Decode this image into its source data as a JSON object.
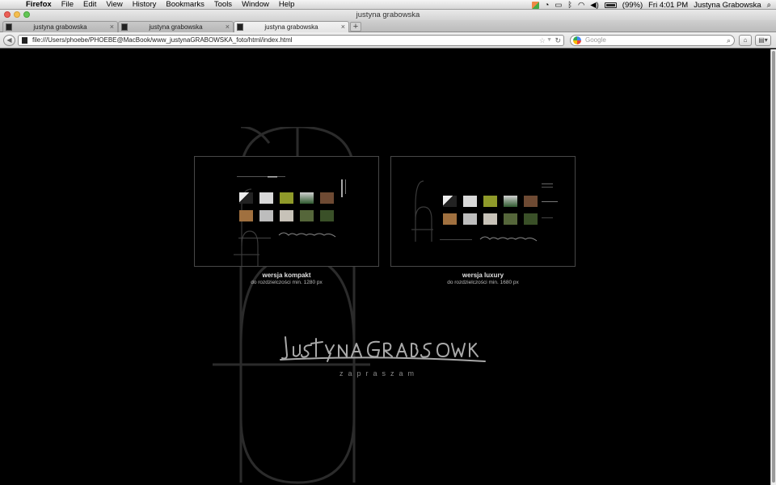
{
  "menubar": {
    "app_name": "Firefox",
    "menus": [
      "File",
      "Edit",
      "View",
      "History",
      "Bookmarks",
      "Tools",
      "Window",
      "Help"
    ],
    "battery": "(99%)",
    "clock": "Fri 4:01 PM",
    "user": "Justyna Grabowska"
  },
  "window": {
    "title": "justyna grabowska"
  },
  "tabs": [
    {
      "label": "justyna grabowska",
      "active": false
    },
    {
      "label": "justyna grabowska",
      "active": false
    },
    {
      "label": "justyna grabowska",
      "active": true
    }
  ],
  "new_tab_label": "+",
  "navbar": {
    "url": "file:///Users/phoebe/PHOEBE@MacBook/www_justynaGRABOWSKA_foto/html/index.html",
    "search_placeholder": "Google"
  },
  "page": {
    "previews": [
      {
        "title": "wersja kompakt",
        "subtitle": "do rozdzielczości min. 1280 px"
      },
      {
        "title": "wersja luxury",
        "subtitle": "do rozdzielczości min. 1680 px"
      }
    ],
    "signature_text": "JUSTYNA GRABOWSKA",
    "invite": "zapraszam"
  },
  "colors": {
    "background": "#000000",
    "accent_gray": "#8a8a8a",
    "frame": "#474747"
  },
  "icons": [
    "apple-icon",
    "flag-icon",
    "time-machine-icon",
    "display-icon",
    "bluetooth-icon",
    "wifi-icon",
    "volume-icon",
    "battery-icon",
    "spotlight-icon"
  ]
}
